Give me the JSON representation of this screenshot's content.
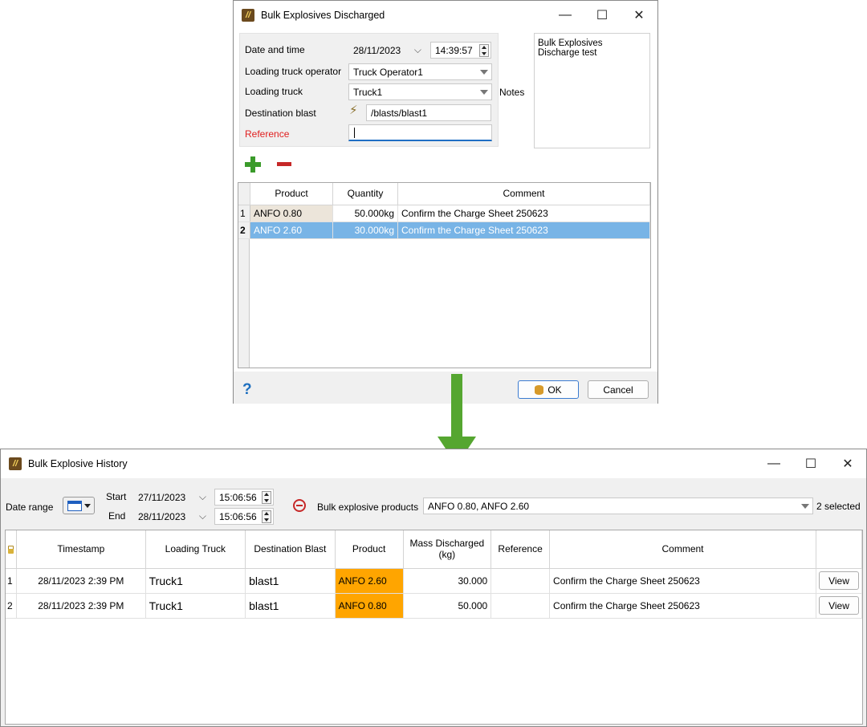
{
  "dialog": {
    "title": "Bulk Explosives Discharged",
    "date_label": "Date and time",
    "date_value": "28/11/2023",
    "time_value": "14:39:57",
    "operator_label": "Loading truck operator",
    "operator_value": "Truck Operator1",
    "truck_label": "Loading truck",
    "truck_value": "Truck1",
    "blast_label": "Destination blast",
    "blast_value": "/blasts/blast1",
    "reference_label": "Reference",
    "reference_value": "",
    "notes_label": "Notes",
    "notes_value": "Bulk Explosives Discharge test",
    "table": {
      "headers": [
        "Product",
        "Quantity",
        "Comment"
      ],
      "rows": [
        {
          "num": "1",
          "product": "ANFO 0.80",
          "quantity": "50.000kg",
          "comment": "Confirm the Charge Sheet 250623"
        },
        {
          "num": "2",
          "product": "ANFO 2.60",
          "quantity": "30.000kg",
          "comment": "Confirm the Charge Sheet 250623"
        }
      ]
    },
    "ok_label": "OK",
    "cancel_label": "Cancel",
    "help_glyph": "?"
  },
  "history": {
    "title": "Bulk Explosive History",
    "date_range_label": "Date range",
    "start_label": "Start",
    "start_date": "27/11/2023",
    "start_time": "15:06:56",
    "end_label": "End",
    "end_date": "28/11/2023",
    "end_time": "15:06:56",
    "products_label": "Bulk explosive products",
    "products_value": "ANFO 0.80, ANFO 2.60",
    "selected_count": "2 selected",
    "headers": {
      "timestamp": "Timestamp",
      "truck": "Loading Truck",
      "blast": "Destination Blast",
      "product": "Product",
      "mass": "Mass Discharged (kg)",
      "reference": "Reference",
      "comment": "Comment"
    },
    "rows": [
      {
        "num": "1",
        "timestamp": "28/11/2023 2:39 PM",
        "truck": "Truck1",
        "blast": "blast1",
        "product": "ANFO 2.60",
        "mass": "30.000",
        "reference": "",
        "comment": "Confirm the Charge Sheet 250623",
        "action": "View"
      },
      {
        "num": "2",
        "timestamp": "28/11/2023 2:39 PM",
        "truck": "Truck1",
        "blast": "blast1",
        "product": "ANFO 0.80",
        "mass": "50.000",
        "reference": "",
        "comment": "Confirm the Charge Sheet 250623",
        "action": "View"
      }
    ]
  },
  "colors": {
    "accent_plus": "#3a9b2a",
    "accent_minus": "#c62828",
    "selection": "#78b4e6",
    "product_highlight": "#ffa500",
    "arrow": "#55a630"
  }
}
